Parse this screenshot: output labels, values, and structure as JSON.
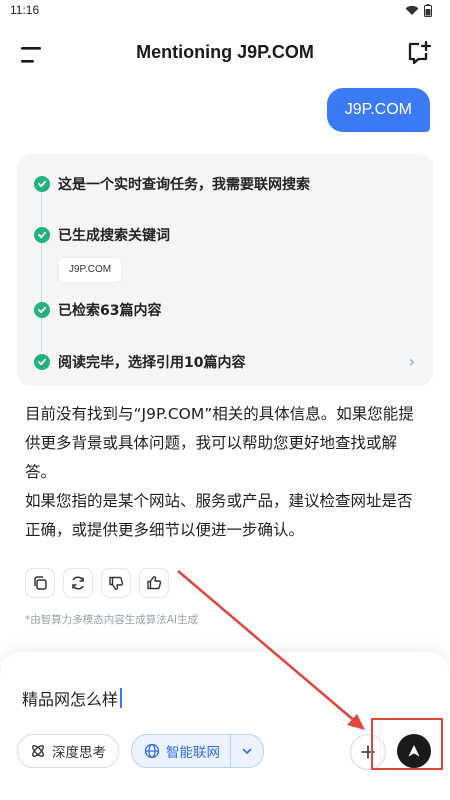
{
  "status_bar": {
    "time": "11:16"
  },
  "header": {
    "title": "Mentioning J9P.COM"
  },
  "chat": {
    "user_message": "J9P.COM",
    "search_steps": [
      {
        "label": "这是一个实时查询任务，我需要联网搜索"
      },
      {
        "label": "已生成搜索关键词",
        "keyword": "J9P.COM"
      },
      {
        "label": "已检索63篇内容"
      },
      {
        "label": "阅读完毕，选择引用10篇内容"
      }
    ],
    "answer_paragraphs": [
      "目前没有找到与“J9P.COM”相关的具体信息。如果您能提供更多背景或具体问题，我可以帮助您更好地查找或解答。",
      "如果您指的是某个网站、服务或产品，建议检查网址是否正确，或提供更多细节以便进一步确认。"
    ],
    "actions": [
      "copy-icon",
      "regenerate-icon",
      "thumbs-down-icon",
      "thumbs-up-icon"
    ],
    "disclaimer": "*由智算力多模态内容生成算法AI生成"
  },
  "composer": {
    "input_value": "精品网怎么样",
    "deep_think_label": "深度思考",
    "web_search_label": "智能联网"
  },
  "colors": {
    "accent": "#3a7bf5",
    "check_green": "#23b27b",
    "annotation_red": "#e2463a"
  }
}
